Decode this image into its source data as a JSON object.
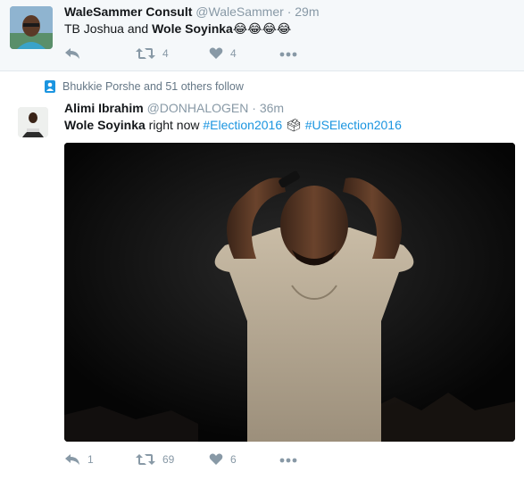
{
  "tweet1": {
    "name": "WaleSammer Consult",
    "handle": "@WaleSammer",
    "separator": "·",
    "time": "29m",
    "text_part1": "TB Joshua and ",
    "text_bold": "Wole Soyinka",
    "text_emoji": "😂😂😂😂",
    "retweet_count": "4",
    "like_count": "4"
  },
  "tweet2": {
    "context": "Bhukkie Porshe and 51 others follow",
    "name": "Alimi Ibrahim",
    "handle": "@DONHALOGEN",
    "separator": "·",
    "time": "36m",
    "text_bold": "Wole Soyinka",
    "text_plain": " right now ",
    "hashtag1": "#Election2016",
    "ballot_emoji": "🗳",
    "hashtag2": "#USElection2016",
    "reply_count": "1",
    "retweet_count": "69",
    "like_count": "6"
  },
  "icons": {
    "reply": "reply-icon",
    "retweet": "retweet-icon",
    "like": "heart-icon",
    "more": "more-icon",
    "follow_context": "person-icon"
  },
  "colors": {
    "hashtag": "#1b95e0",
    "muted": "#8899a6",
    "highlight_bg": "#f5f8fa"
  }
}
